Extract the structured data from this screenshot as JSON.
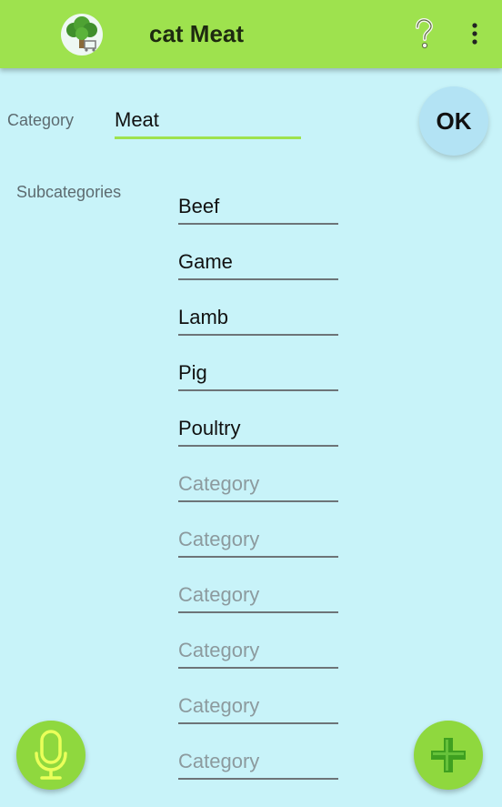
{
  "appbar": {
    "title": "cat Meat",
    "icons": [
      "broccoli-cart-icon",
      "help-icon",
      "overflow-menu-icon"
    ],
    "color": "#9ee24e"
  },
  "category": {
    "label": "Category",
    "value": "Meat"
  },
  "ok_button": {
    "label": "OK"
  },
  "subcategories": {
    "label": "Subcategories",
    "placeholder": "Category",
    "items": [
      {
        "value": "Beef"
      },
      {
        "value": "Game"
      },
      {
        "value": "Lamb"
      },
      {
        "value": "Pig"
      },
      {
        "value": "Poultry"
      },
      {
        "value": ""
      },
      {
        "value": ""
      },
      {
        "value": ""
      },
      {
        "value": ""
      },
      {
        "value": ""
      },
      {
        "value": ""
      }
    ]
  },
  "actions": {
    "mic_icon": "microphone-icon",
    "add_icon": "plus-icon"
  },
  "colors": {
    "background": "#c8f3f9",
    "accent": "#9ee24e"
  }
}
